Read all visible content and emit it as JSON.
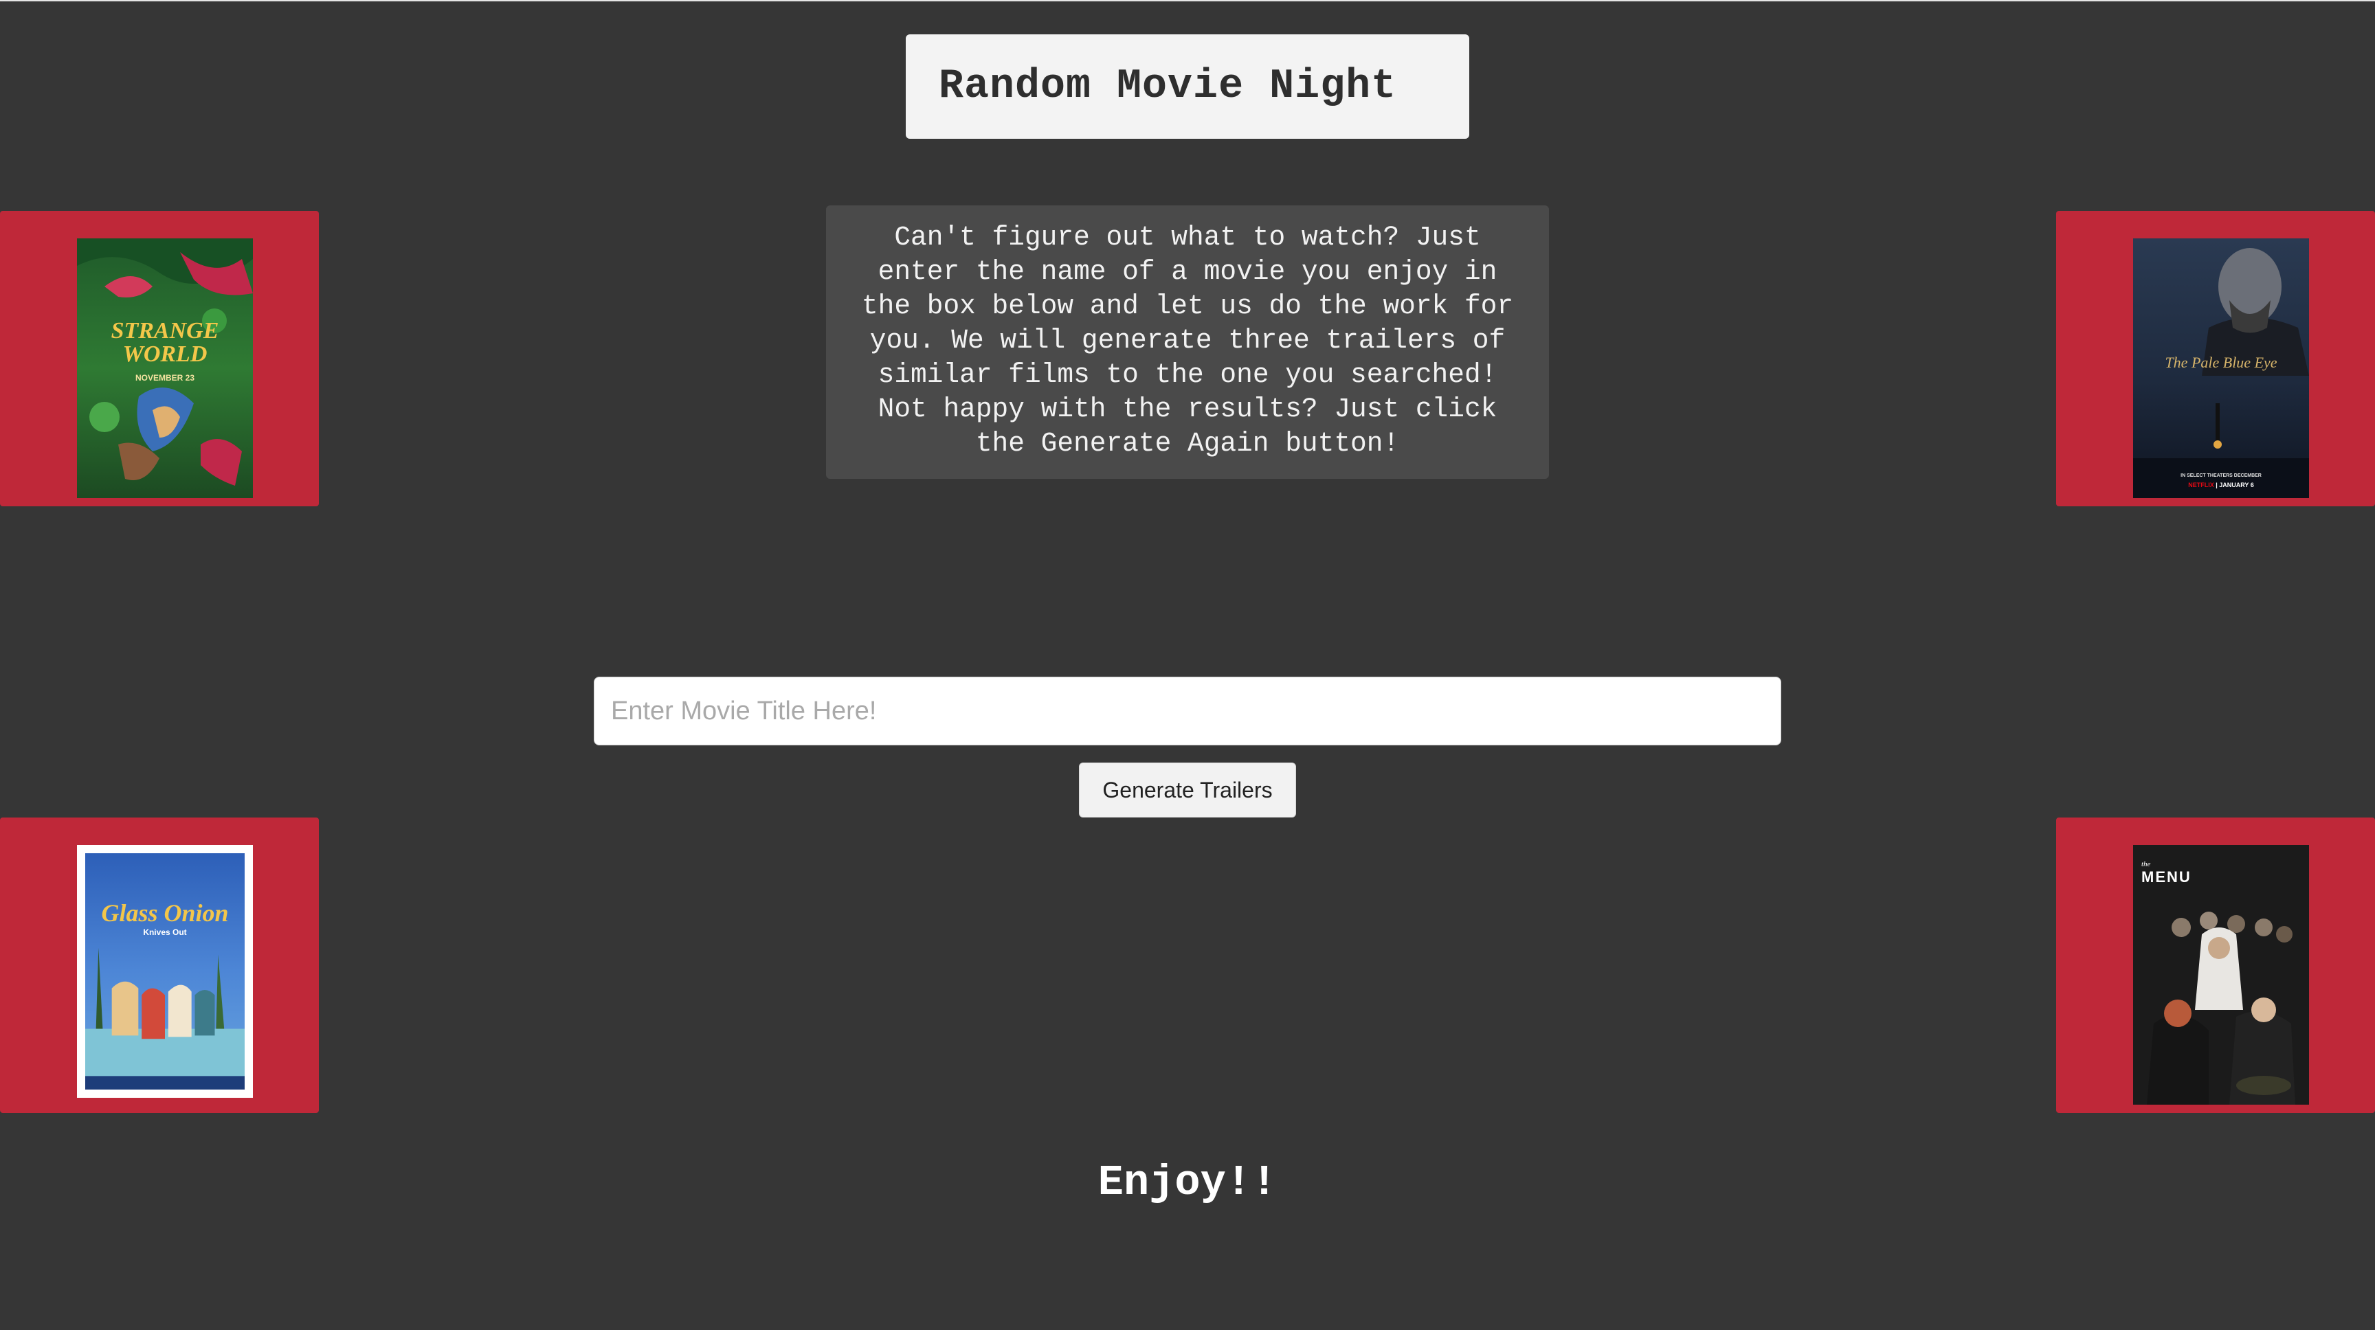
{
  "header": {
    "title": "Random Movie Night"
  },
  "intro": {
    "text": "Can't figure out what to watch? Just enter the name of a movie you enjoy in the box below and let us do the work for you. We will generate three trailers of similar films to the one you searched! Not happy with the results? Just click the Generate Again button!"
  },
  "search": {
    "placeholder": "Enter Movie Title Here!",
    "value": ""
  },
  "button": {
    "label": "Generate Trailers"
  },
  "footer": {
    "text": "Enjoy!!"
  },
  "posters": {
    "top_left": {
      "title_line1": "STRANGE",
      "title_line2": "WORLD",
      "tagline": "NOVEMBER 23"
    },
    "top_right": {
      "title": "The Pale Blue Eye",
      "release": "IN SELECT THEATERS DECEMBER",
      "network": "NETFLIX",
      "date": "JANUARY 6"
    },
    "bottom_left": {
      "title": "Glass Onion",
      "subtitle": "Knives Out"
    },
    "bottom_right": {
      "title_small": "the",
      "title": "MENU"
    }
  },
  "colors": {
    "background": "#363636",
    "panel": "#bf2839",
    "title_box": "#f3f3f3",
    "desc_box": "#4a4a4a"
  }
}
